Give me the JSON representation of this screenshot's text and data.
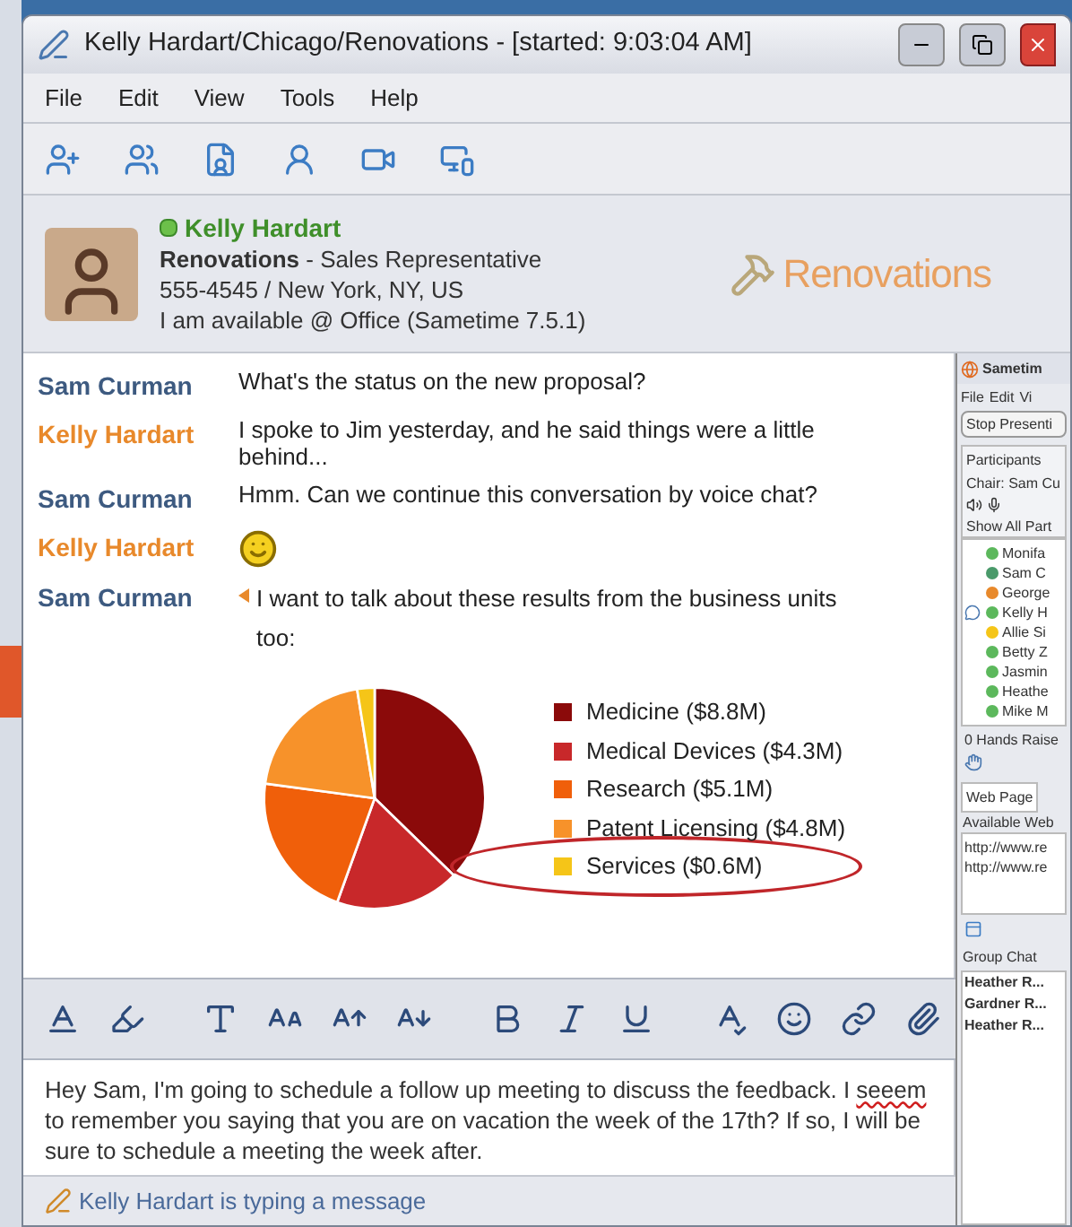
{
  "window": {
    "title": "Kelly Hardart/Chicago/Renovations - [started: 9:03:04 AM]"
  },
  "menu": [
    "File",
    "Edit",
    "View",
    "Tools",
    "Help"
  ],
  "contact": {
    "name": "Kelly Hardart",
    "online": true,
    "company": "Renovations",
    "role": " - Sales Representative",
    "phone": "555-4545 / New York, NY, US",
    "status": "I am available @ Office (Sametime 7.5.1)",
    "logo_text": "Renovations"
  },
  "messages": [
    {
      "sender": "Sam Curman",
      "color": "#3d5a80",
      "kind": "text",
      "marked": false,
      "text": "What's the status on the new proposal?"
    },
    {
      "sender": "Kelly Hardart",
      "color": "#e8892b",
      "kind": "text",
      "marked": false,
      "text": "I spoke to Jim yesterday, and he said things were a little behind..."
    },
    {
      "sender": "Sam Curman",
      "color": "#3d5a80",
      "kind": "text",
      "marked": false,
      "text": "Hmm. Can we continue this conversation by voice chat?"
    },
    {
      "sender": "Kelly Hardart",
      "color": "#e8892b",
      "kind": "emoticon",
      "marked": false
    },
    {
      "sender": "Sam Curman",
      "color": "#3d5a80",
      "kind": "text",
      "marked": true,
      "text": "I want to talk about these results from the business units too:"
    }
  ],
  "chart": {
    "circled": [
      false,
      false,
      false,
      false,
      true
    ],
    "chart_data": {
      "type": "pie",
      "legend": "right",
      "categories": [
        "Medicine ($8.8M)",
        "Medical Devices ($4.3M)",
        "Research ($5.1M)",
        "Patent Licensing ($4.8M)",
        "Services ($0.6M)"
      ],
      "values": [
        8.8,
        4.3,
        5.1,
        4.8,
        0.6
      ],
      "colors": [
        "#8b0a0a",
        "#c8282a",
        "#f05f0a",
        "#f7922a",
        "#f5c518"
      ]
    }
  },
  "draft": [
    {
      "text": "Hey Sam, I'm going to schedule a follow up meeting to discuss the feedback. I ",
      "misspelled": false
    },
    {
      "text": "seeem",
      "misspelled": true
    },
    {
      "text": " to remember you saying that you are on vacation the week of the 17th? If so, I will be sure to schedule a meeting the week after.",
      "misspelled": false
    }
  ],
  "status_bar": "Kelly Hardart is typing a message",
  "meeting_panel": {
    "title": "Sametim",
    "menu": [
      "File",
      "Edit",
      "Vi"
    ],
    "stop_button": "Stop Presenti",
    "participants_label": "Participants",
    "chair": "Chair: Sam Cu",
    "show_label": "Show All Part",
    "participants": [
      {
        "name": "Monifa",
        "color": "#5cb85c",
        "chatting": false
      },
      {
        "name": "Sam C",
        "color": "#4a9a6a",
        "chatting": false
      },
      {
        "name": "George",
        "color": "#e8892b",
        "chatting": false
      },
      {
        "name": "Kelly H",
        "color": "#5cb85c",
        "chatting": true
      },
      {
        "name": "Allie Si",
        "color": "#f5c518",
        "chatting": false
      },
      {
        "name": "Betty Z",
        "color": "#5cb85c",
        "chatting": false
      },
      {
        "name": "Jasmin",
        "color": "#5cb85c",
        "chatting": false
      },
      {
        "name": "Heathe",
        "color": "#5cb85c",
        "chatting": false
      },
      {
        "name": "Mike M",
        "color": "#5cb85c",
        "chatting": false
      }
    ],
    "hands": "0 Hands Raise",
    "tab": "Web Page",
    "available": "Available Web",
    "urls": [
      "http://www.re",
      "http://www.re"
    ],
    "group_chat": "Group Chat",
    "chat_names": [
      "Heather R...",
      "Gardner R...",
      "Heather R..."
    ]
  }
}
